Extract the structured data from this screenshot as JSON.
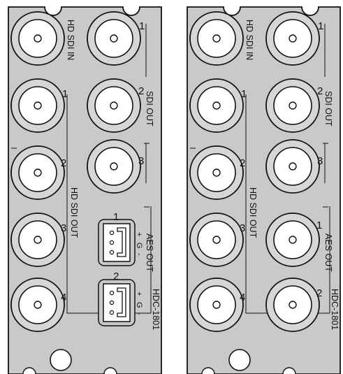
{
  "panels": [
    {
      "labels": {
        "hd_sdi_in": "HD SDI IN",
        "sdi_out": "SDI OUT",
        "hd_sdi_out": "HD SDI OUT",
        "aes_out": "AES OUT",
        "model": "HDC-1801"
      },
      "left_connector_numbers": [
        "1",
        "2",
        "3",
        "4"
      ],
      "right_connector_numbers": [
        "1",
        "2",
        "3"
      ],
      "aes_terminal_numbers": [
        "1",
        "2"
      ],
      "terminal_pins": [
        "+",
        "G",
        "-"
      ]
    },
    {
      "labels": {
        "hd_sdi_in": "HD SDI IN",
        "sdi_out": "SDI OUT",
        "hd_sdi_out": "HD SDI OUT",
        "aes_out": "AES OUT",
        "model": "HDC-1801"
      },
      "left_connector_numbers": [
        "1",
        "2",
        "3",
        "4"
      ],
      "right_connector_numbers": [
        "1",
        "2",
        "3",
        "1",
        "2"
      ]
    }
  ],
  "colors": {
    "panel": "#c9c9c9",
    "outline": "#111111",
    "connector_face": "#ffffff"
  }
}
